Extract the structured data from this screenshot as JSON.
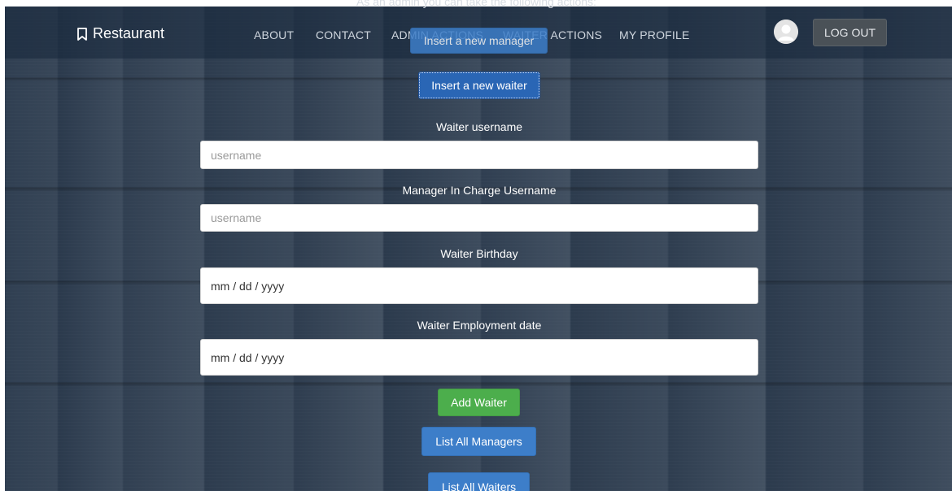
{
  "brand": {
    "name": "Restaurant",
    "icon": "bookmark-icon"
  },
  "nav": {
    "items": [
      "ABOUT",
      "CONTACT",
      "ADMIN ACTIONS",
      "WAITER ACTIONS",
      "MY PROFILE"
    ],
    "admin_note": "As an admin you can take the following actions:",
    "logout_label": "LOG OUT",
    "avatar_icon": "user-avatar-icon"
  },
  "actions": {
    "insert_manager": "Insert a new manager",
    "insert_waiter": "Insert a new waiter",
    "add_waiter": "Add Waiter",
    "list_managers": "List All Managers",
    "list_waiters": "List All Waiters"
  },
  "form": {
    "waiter_username_label": "Waiter username",
    "waiter_username_placeholder": "username",
    "manager_username_label": "Manager In Charge Username",
    "manager_username_placeholder": "username",
    "birthday_label": "Waiter Birthday",
    "birthday_value": "mm / dd / yyyy",
    "employment_label": "Waiter Employment date",
    "employment_value": "mm / dd / yyyy"
  },
  "colors": {
    "primary": "#3d7ec9",
    "success": "#4cae4c",
    "navbar": "#16263a"
  }
}
